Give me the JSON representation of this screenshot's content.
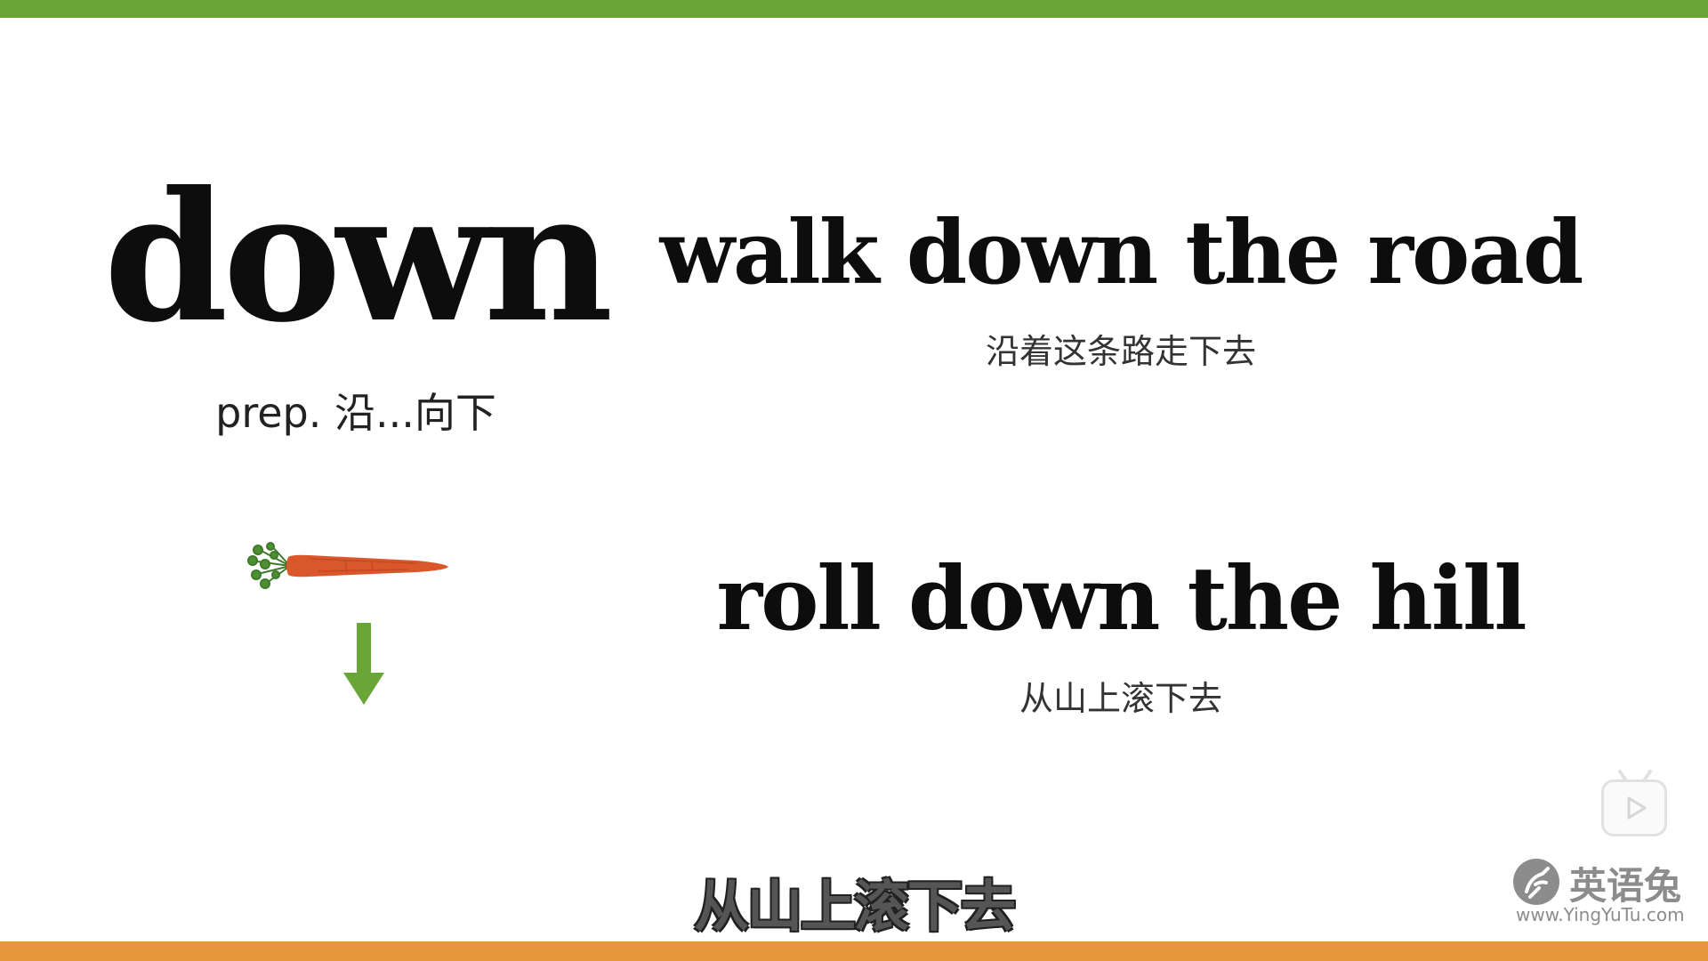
{
  "slide": {
    "headword": "down",
    "part_of_speech": "prep. 沿...向下",
    "examples": [
      {
        "phrase": "walk down the road",
        "translation": "沿着这条路走下去"
      },
      {
        "phrase": "roll down the hill",
        "translation": "从山上滚下去"
      }
    ],
    "illustration": {
      "object_icon": "carrot-icon",
      "direction_icon": "down-arrow-icon"
    }
  },
  "player": {
    "subtitle": "从山上滚下去",
    "play_badge_icon": "video-play-icon"
  },
  "watermark": {
    "name": "英语兔",
    "url": "www.YingYuTu.com"
  },
  "colors": {
    "top_bar": "#6aa537",
    "bottom_bar": "#e8963a",
    "arrow": "#6aa537",
    "carrot": "#d9572b",
    "text": "#0d0d0d"
  }
}
